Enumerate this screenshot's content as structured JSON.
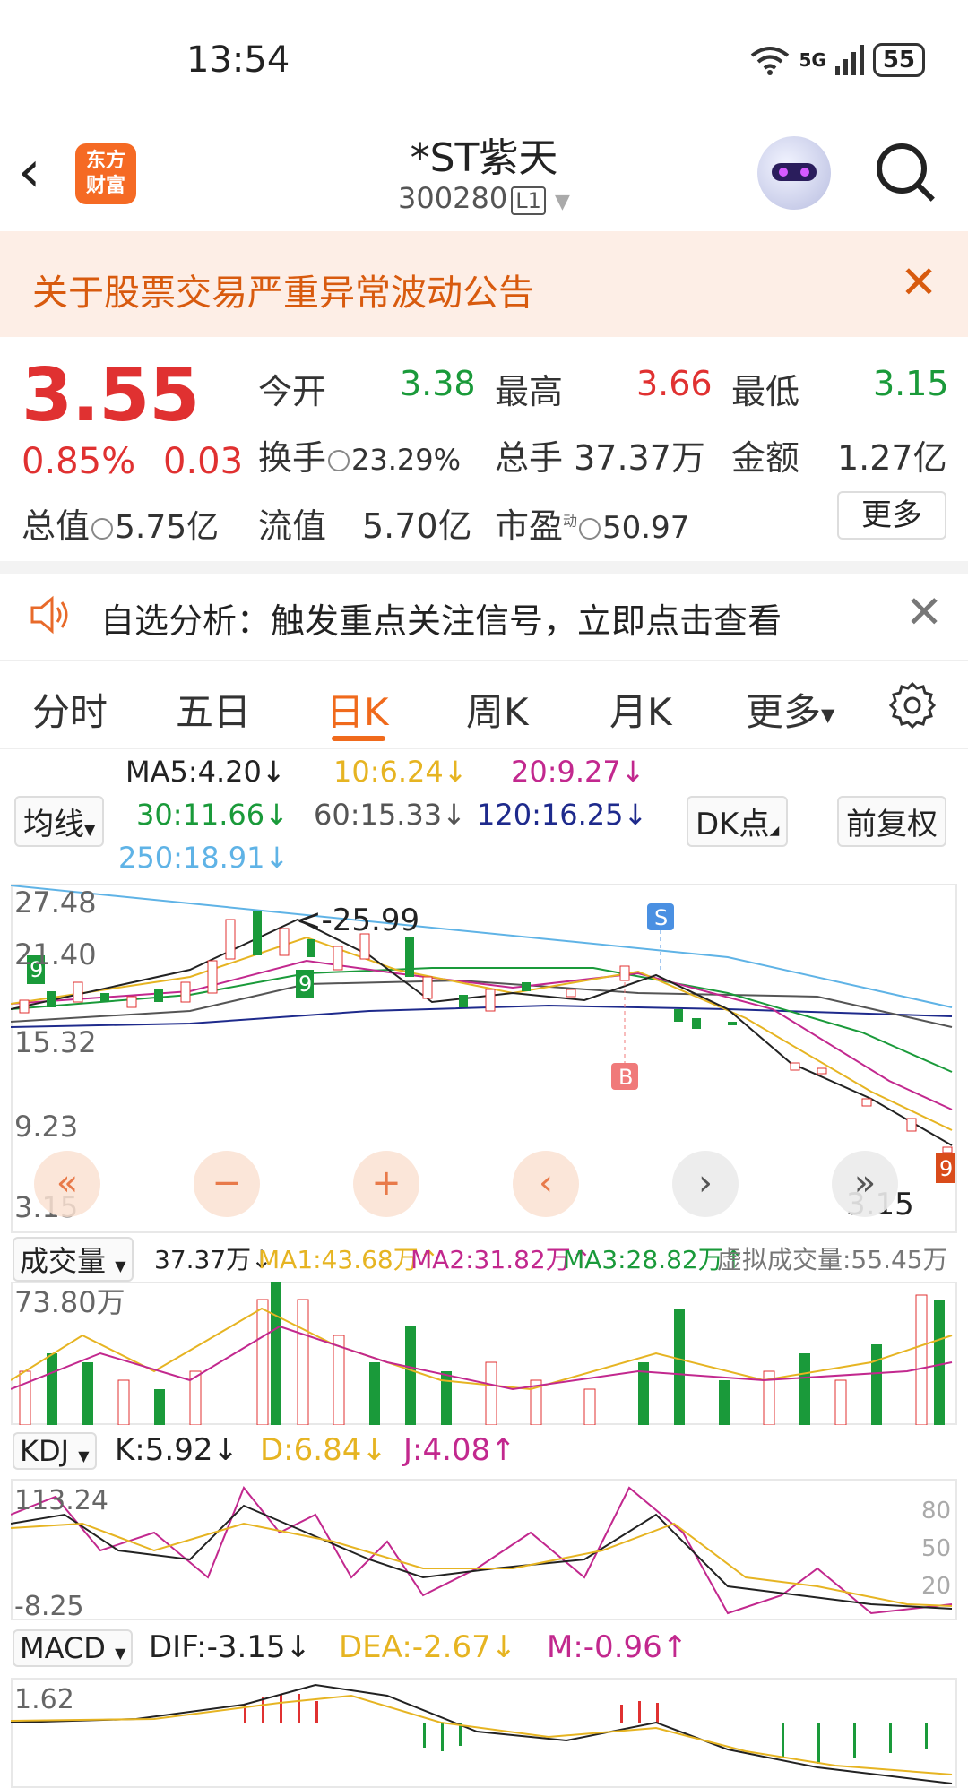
{
  "status_bar": {
    "time": "13:54",
    "network": "5G",
    "battery": "55"
  },
  "nav": {
    "logo": [
      "东方",
      "财富"
    ],
    "title": "*ST紫天",
    "code": "300280",
    "level": "L1"
  },
  "notice": {
    "text": "关于股票交易严重异常波动公告"
  },
  "quote": {
    "price": "3.55",
    "change_pct": "0.85%",
    "change": "0.03",
    "open_label": "今开",
    "open": "3.38",
    "high_label": "最高",
    "high": "3.66",
    "low_label": "最低",
    "low": "3.15",
    "turnover_label": "换手",
    "turnover": "23.29%",
    "volume_label": "总手",
    "volume": "37.37万",
    "amount_label": "金额",
    "amount": "1.27亿",
    "mktcap_label": "总值",
    "mktcap": "5.75亿",
    "float_label": "流值",
    "float": "5.70亿",
    "pe_label": "市盈",
    "pe_sup": "动",
    "pe": "50.97",
    "more": "更多"
  },
  "signal": {
    "text": "自选分析：触发重点关注信号，立即点击查看"
  },
  "tabs": [
    "分时",
    "五日",
    "日K",
    "周K",
    "月K",
    "更多"
  ],
  "ma": {
    "dropdown": "均线",
    "ma5": "MA5:4.20↓",
    "ma10": "10:6.24↓",
    "ma20": "20:9.27↓",
    "ma30": "30:11.66↓",
    "ma60": "60:15.33↓",
    "ma120": "120:16.25↓",
    "ma250": "250:18.91↓",
    "dk": "DK点",
    "adjust": "前复权"
  },
  "kline": {
    "y_labels": [
      "27.48",
      "21.40",
      "15.32",
      "9.23",
      "3.15"
    ],
    "peak_label": "<-25.99",
    "last_label": "3.15",
    "signal_s": "S",
    "signal_b": "B"
  },
  "volume": {
    "dropdown": "成交量",
    "vol": "37.37万↓",
    "ma1": "MA1:43.68万↑",
    "ma2": "MA2:31.82万↑",
    "ma3": "MA3:28.82万↑",
    "virtual": "虚拟成交量:55.45万",
    "y_label": "73.80万"
  },
  "kdj": {
    "dropdown": "KDJ",
    "k": "K:5.92↓",
    "d": "D:6.84↓",
    "j": "J:4.08↑",
    "y_top": "113.24",
    "y_bottom": "-8.25",
    "levels": [
      "80",
      "50",
      "20"
    ]
  },
  "macd": {
    "dropdown": "MACD",
    "dif": "DIF:-3.15↓",
    "dea": "DEA:-2.67↓",
    "m": "M:-0.96↑",
    "y_top": "1.62"
  },
  "colors": {
    "up": "#e03131",
    "down": "#1a9a3a",
    "accent": "#f06a1c",
    "ma10": "#e6b422",
    "ma20": "#c2288e",
    "ma30": "#1a9a3a",
    "ma60": "#555555",
    "ma120": "#1e2a8c",
    "ma250": "#5fb3e6"
  }
}
